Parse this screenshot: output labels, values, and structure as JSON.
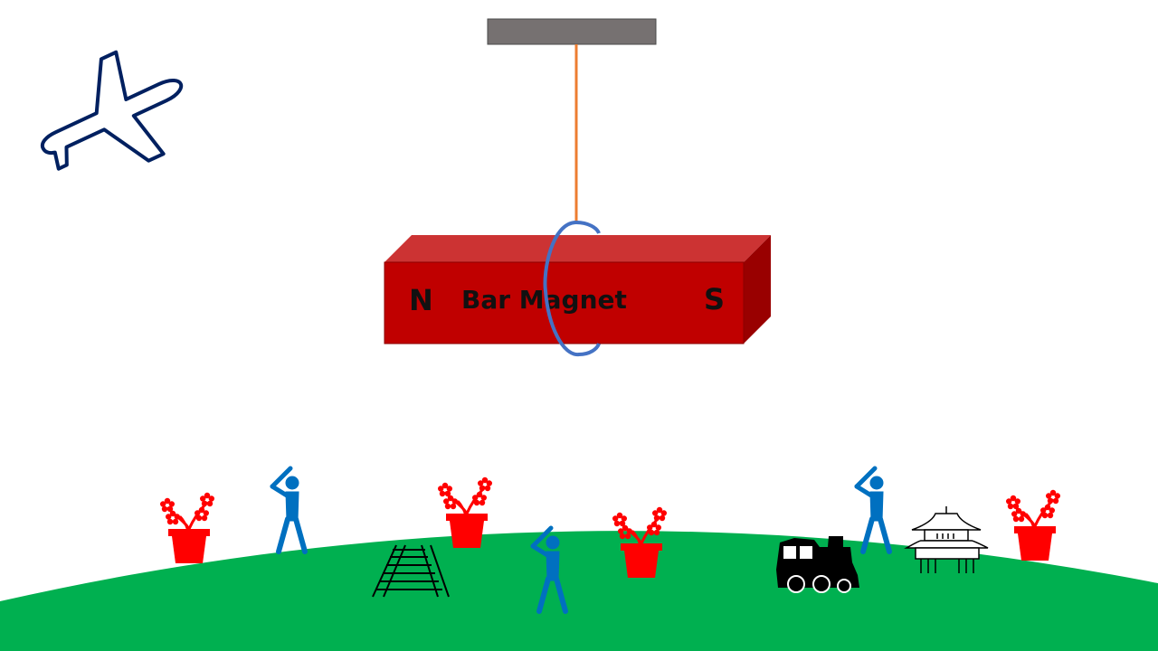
{
  "magnet": {
    "label": "Bar Magnet",
    "north_pole": "N",
    "south_pole": "S"
  },
  "colors": {
    "magnet_front": "#c00000",
    "magnet_top": "#cc3333",
    "magnet_side": "#990000",
    "support_bar": "#767171",
    "string": "#ed7d31",
    "loop": "#4472c4",
    "ground": "#00b050",
    "airplane": "#002060",
    "person": "#0070c0",
    "flower": "#ff0000",
    "train": "#000000"
  },
  "icons": [
    "airplane-icon",
    "flower-pot-icon",
    "baseball-player-icon",
    "railroad-track-icon",
    "steam-train-icon",
    "pagoda-icon"
  ]
}
